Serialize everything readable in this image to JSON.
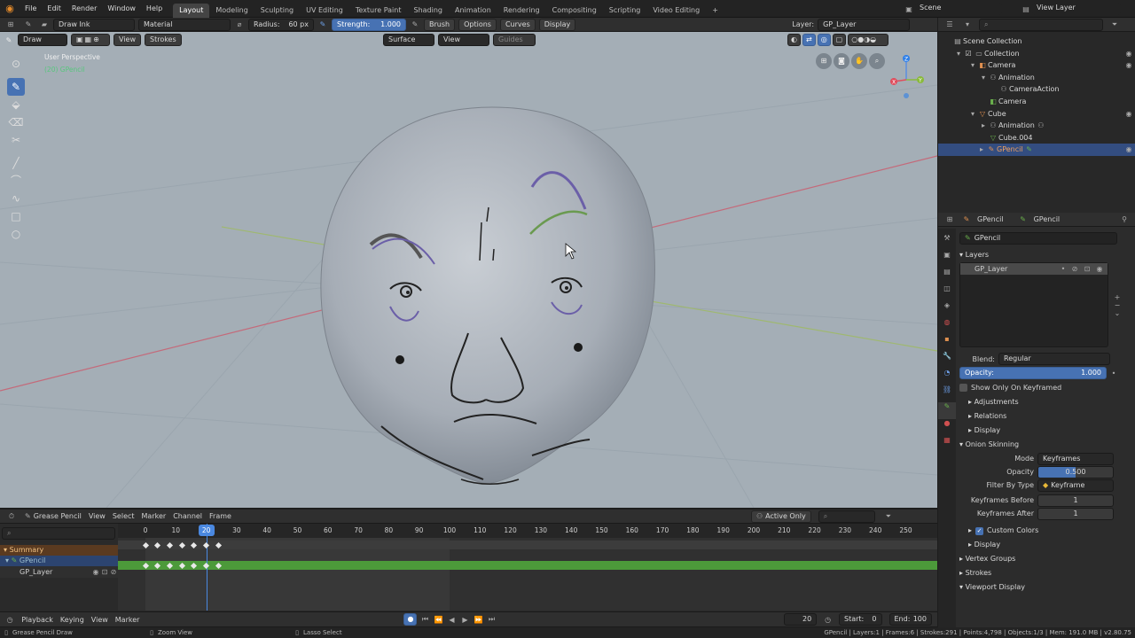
{
  "menubar": {
    "menus": [
      "File",
      "Edit",
      "Render",
      "Window",
      "Help"
    ],
    "workspaces": [
      "Layout",
      "Modeling",
      "Sculpting",
      "UV Editing",
      "Texture Paint",
      "Shading",
      "Animation",
      "Rendering",
      "Compositing",
      "Scripting",
      "Video Editing"
    ],
    "active_workspace": "Layout",
    "add_tab": "+",
    "scene": "Scene",
    "view_layer": "View Layer"
  },
  "tool_header": {
    "brush_name": "Draw Ink",
    "material": "Material",
    "radius_label": "Radius:",
    "radius_value": "60 px",
    "strength_label": "Strength:",
    "strength_value": "1.000",
    "menus": [
      "Brush",
      "Options",
      "Curves",
      "Display"
    ],
    "layer_label": "Layer:",
    "layer_value": "GP_Layer"
  },
  "viewport_header": {
    "mode": "Draw",
    "view": "View",
    "strokes": "Strokes",
    "surface": "Surface",
    "view2": "View",
    "guides": "Guides"
  },
  "viewport": {
    "perspective": "User Perspective",
    "object_label": "(20) GPencil",
    "axes": {
      "x": "X",
      "y": "Y",
      "z": "Z"
    }
  },
  "outliner": {
    "items": [
      {
        "label": "Scene Collection",
        "type": "collection"
      },
      {
        "label": "Collection",
        "type": "collection"
      },
      {
        "label": "Camera",
        "type": "object"
      },
      {
        "label": "Animation",
        "type": "anim"
      },
      {
        "label": "CameraAction",
        "type": "action"
      },
      {
        "label": "Camera",
        "type": "data"
      },
      {
        "label": "Cube",
        "type": "object"
      },
      {
        "label": "Animation",
        "type": "anim"
      },
      {
        "label": "Cube.004",
        "type": "data"
      },
      {
        "label": "GPencil",
        "type": "object"
      }
    ]
  },
  "properties": {
    "breadcrumb": [
      "GPencil",
      "GPencil"
    ],
    "data_name": "GPencil",
    "layers_title": "Layers",
    "layer_item": "GP_Layer",
    "blend_label": "Blend:",
    "blend_value": "Regular",
    "opacity_label": "Opacity:",
    "opacity_value": "1.000",
    "show_only_keyframed": "Show Only On Keyframed",
    "sub_panels": [
      "Adjustments",
      "Relations",
      "Display"
    ],
    "onion_title": "Onion Skinning",
    "mode_label": "Mode",
    "mode_value": "Keyframes",
    "onion_opacity_label": "Opacity",
    "onion_opacity_value": "0.500",
    "filter_label": "Filter By Type",
    "filter_value": "Keyframe",
    "kf_before_label": "Keyframes Before",
    "kf_before_value": "1",
    "kf_after_label": "Keyframes After",
    "kf_after_value": "1",
    "custom_colors": "Custom Colors",
    "display2": "Display",
    "vertex_groups": "Vertex Groups",
    "strokes": "Strokes",
    "viewport_display": "Viewport Display"
  },
  "timeline": {
    "editor": "Grease Pencil",
    "menus": [
      "View",
      "Select",
      "Marker",
      "Channel",
      "Frame"
    ],
    "active_only": "Active Only",
    "frame_numbers": [
      "0",
      "10",
      "20",
      "30",
      "40",
      "50",
      "60",
      "70",
      "80",
      "90",
      "100",
      "110",
      "120",
      "130",
      "140",
      "150",
      "160",
      "170",
      "180",
      "190",
      "200",
      "210",
      "220",
      "230",
      "240",
      "250"
    ],
    "current_frame": "20",
    "channels": [
      "Summary",
      "GPencil",
      "GP_Layer"
    ],
    "keyframes": [
      0,
      4,
      8,
      12,
      16,
      20,
      24
    ],
    "playback_menus": [
      "Playback",
      "Keying",
      "View",
      "Marker"
    ],
    "frame_field": "20",
    "start_label": "Start:",
    "start_value": "0",
    "end_label": "End:",
    "end_value": "100"
  },
  "status_bar": {
    "left1": "Grease Pencil Draw",
    "left2": "Zoom View",
    "left3": "Lasso Select",
    "stats": "GPencil | Layers:1 | Frames:6 | Strokes:291 | Points:4,798 | Objects:1/3 | Mem: 191.0 MB | v2.80.75"
  }
}
